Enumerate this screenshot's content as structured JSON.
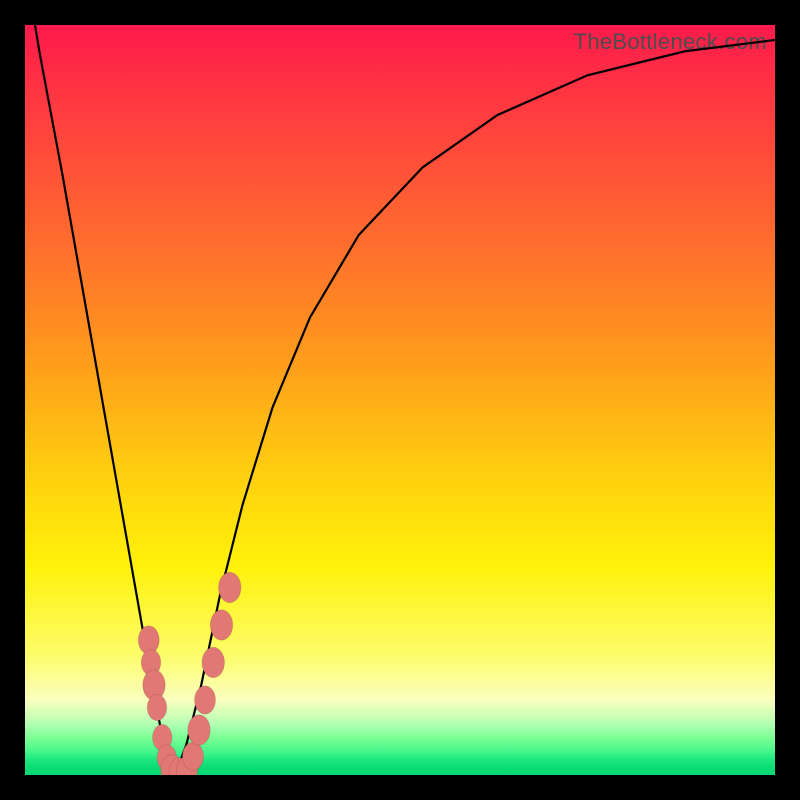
{
  "watermark": "TheBottleneck.com",
  "colors": {
    "curve_stroke": "#000000",
    "marker_fill": "#e27874",
    "marker_stroke": "rgba(0,0,0,0.12)"
  },
  "chart_data": {
    "type": "line",
    "title": "",
    "xlabel": "",
    "ylabel": "",
    "xlim": [
      0,
      100
    ],
    "ylim": [
      0,
      100
    ],
    "series": [
      {
        "name": "bottleneck-curve",
        "x": [
          0,
          2,
          5,
          8,
          11,
          14,
          17,
          18.5,
          20,
          21.5,
          23.5,
          26,
          29,
          33,
          38,
          44.5,
          53,
          63,
          75,
          88,
          100
        ],
        "values": [
          108,
          96,
          80,
          63,
          46,
          29,
          12,
          4,
          0,
          4,
          12,
          24,
          36,
          49,
          61,
          72,
          81,
          88,
          93.3,
          96.5,
          98
        ]
      }
    ],
    "markers": [
      {
        "x": 16.5,
        "y": 18,
        "r": 1.4
      },
      {
        "x": 16.8,
        "y": 15,
        "r": 1.3
      },
      {
        "x": 17.2,
        "y": 12,
        "r": 1.5
      },
      {
        "x": 17.6,
        "y": 9,
        "r": 1.3
      },
      {
        "x": 18.3,
        "y": 5,
        "r": 1.3
      },
      {
        "x": 18.9,
        "y": 2.3,
        "r": 1.3
      },
      {
        "x": 19.6,
        "y": 0.7,
        "r": 1.5
      },
      {
        "x": 20.6,
        "y": 0.4,
        "r": 1.4
      },
      {
        "x": 21.6,
        "y": 0.6,
        "r": 1.4
      },
      {
        "x": 22.4,
        "y": 2.5,
        "r": 1.4
      },
      {
        "x": 23.2,
        "y": 6,
        "r": 1.5
      },
      {
        "x": 24.0,
        "y": 10,
        "r": 1.4
      },
      {
        "x": 25.1,
        "y": 15,
        "r": 1.5
      },
      {
        "x": 26.2,
        "y": 20,
        "r": 1.5
      },
      {
        "x": 27.3,
        "y": 25,
        "r": 1.5
      }
    ]
  }
}
